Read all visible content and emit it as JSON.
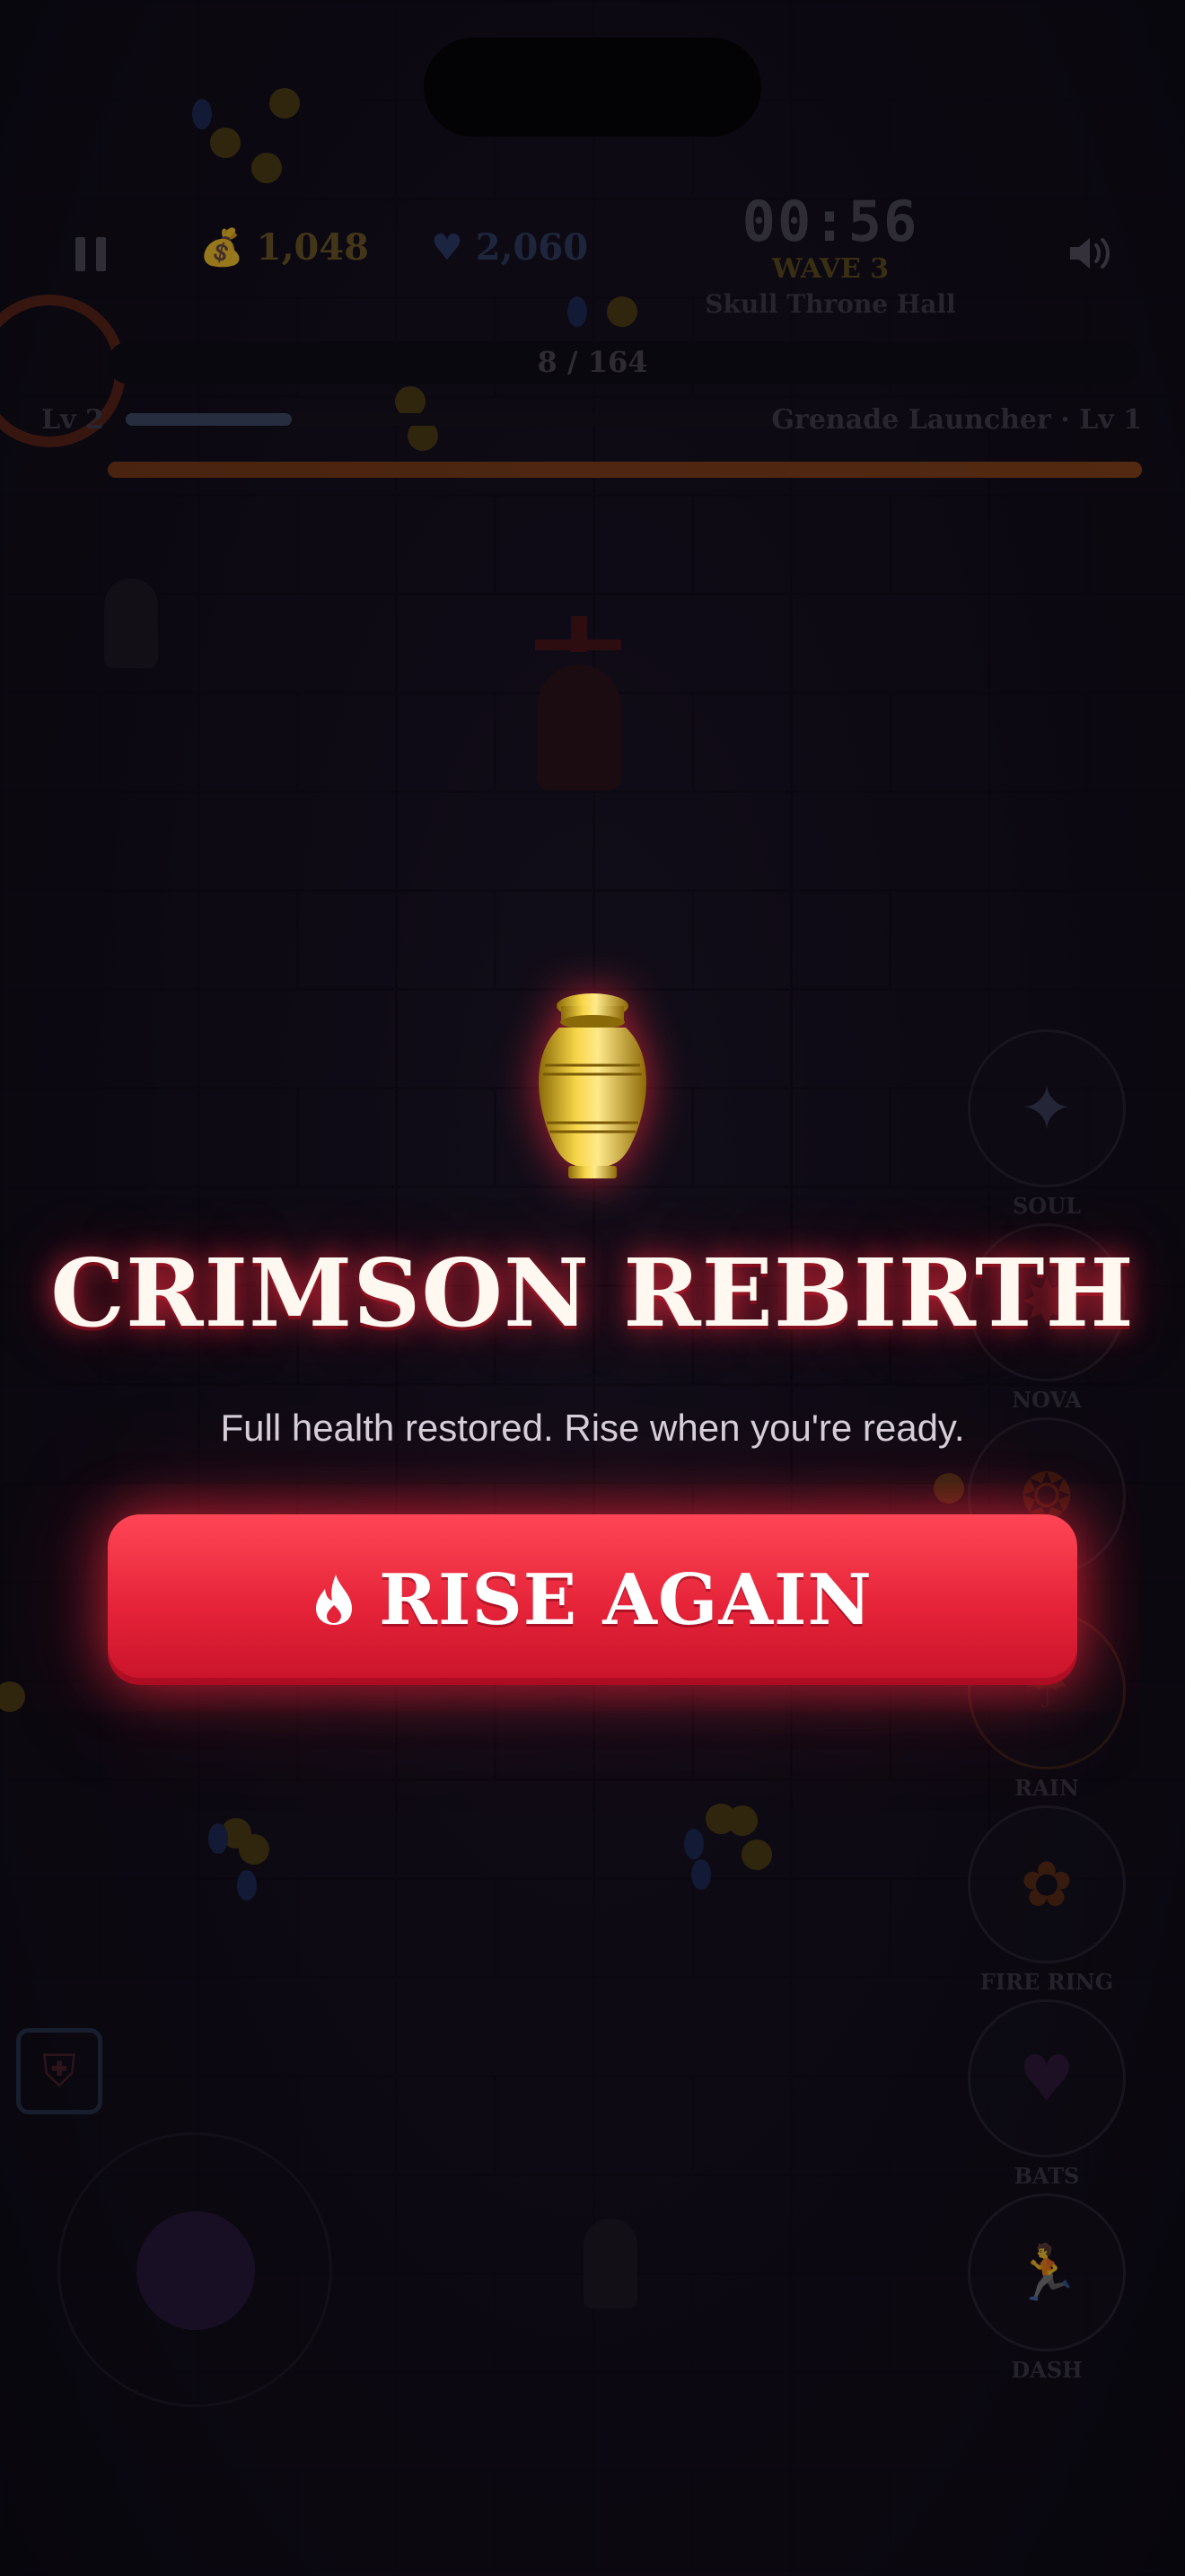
{
  "hud": {
    "gold": "1,048",
    "gems": "2,060",
    "timer": "00:56",
    "wave": "WAVE 3",
    "zone": "Skull Throne Hall",
    "kills": "8 / 164",
    "level": "Lv 2",
    "weapon": "Grenade Launcher · Lv 1",
    "xp_progress": 0.25,
    "hp_progress": 1.0
  },
  "abilities": [
    {
      "label": "SOUL",
      "icon": "sparkle-icon"
    },
    {
      "label": "NOVA",
      "icon": "burst-icon"
    },
    {
      "label": "",
      "icon": "flame-icon"
    },
    {
      "label": "RAIN",
      "icon": "rain-icon"
    },
    {
      "label": "FIRE RING",
      "icon": "fire-ring-icon"
    },
    {
      "label": "BATS",
      "icon": "heart-bolt-icon"
    },
    {
      "label": "DASH",
      "icon": "running-figure-icon"
    }
  ],
  "overlay": {
    "title": "CRIMSON REBIRTH",
    "subtitle": "Full health restored. Rise when you're ready.",
    "button_label": "RISE AGAIN",
    "button_icon": "flame-icon",
    "emblem_icon": "urn-icon"
  },
  "colors": {
    "accent_red": "#e52338",
    "gold": "#c9a227",
    "background": "#0b0912"
  }
}
